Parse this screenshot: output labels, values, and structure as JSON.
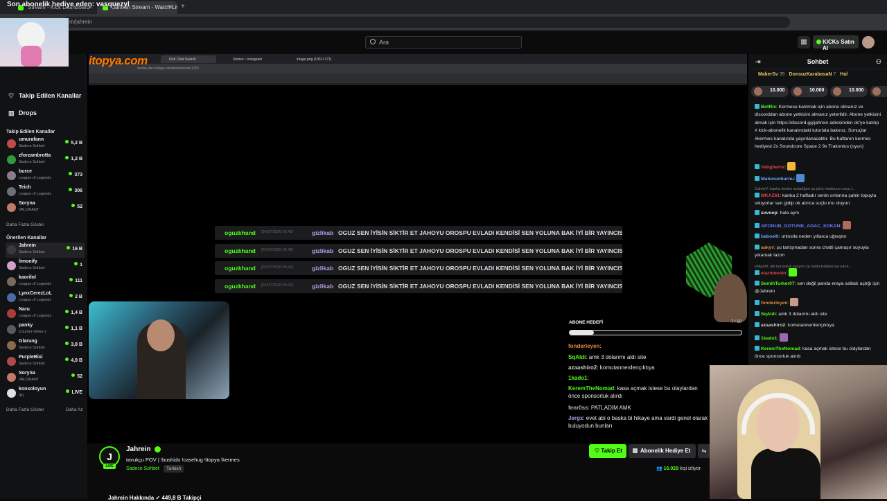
{
  "browser": {
    "tabs": [
      {
        "label": "Stream - Kick Dashboard"
      },
      {
        "label": "Jahrein Stream - Watch Live"
      }
    ],
    "address": "m/jahrein"
  },
  "overlay_banner": "Son abonelik hediye eden: vasquezyl",
  "header": {
    "search_placeholder": "Ara",
    "buy_kicks": "KICKs Satın Al"
  },
  "sidebar": {
    "followed_link": "Takip Edilen Kanallar",
    "drops_link": "Drops",
    "followed_section": "Takip Edilen Kanallar",
    "followed": [
      {
        "name": "umurafann",
        "category": "Sadece Sohbet",
        "viewers": "5,2 B",
        "color": "#c44a4a"
      },
      {
        "name": "zforzambrotta",
        "category": "Sadece Sohbet",
        "viewers": "1,2 B",
        "color": "#2f9b3a"
      },
      {
        "name": "burce",
        "category": "League of Legends",
        "viewers": "373",
        "color": "#8c7b8f"
      },
      {
        "name": "Teich",
        "category": "League of Legends",
        "viewers": "306",
        "color": "#6e6e76"
      },
      {
        "name": "Soryna",
        "category": "VALORANT",
        "viewers": "52",
        "color": "#c27a68"
      }
    ],
    "show_more": "Daha Fazla Göster",
    "recommended_section": "Önerilen Kanallar",
    "recommended": [
      {
        "name": "Jahrein",
        "category": "Sadece Sohbet",
        "viewers": "16 B",
        "color": "#3a3a3a"
      },
      {
        "name": "limonify",
        "category": "Sadece Sohbet",
        "viewers": "1",
        "color": "#d0a0c8"
      },
      {
        "name": "kaorilol",
        "category": "League of Legends",
        "viewers": "111",
        "color": "#7a6a5a"
      },
      {
        "name": "LynxCerezLoL",
        "category": "League of Legends",
        "viewers": "2 B",
        "color": "#4a6aa0"
      },
      {
        "name": "Naru",
        "category": "League of Legends",
        "viewers": "1,4 B",
        "color": "#b03a3a"
      },
      {
        "name": "panky",
        "category": "Counter-Strike 2",
        "viewers": "1,1 B",
        "color": "#5a5a5a"
      },
      {
        "name": "Glarung",
        "category": "Sadece Sohbet",
        "viewers": "3,8 B",
        "color": "#8a6a4a"
      },
      {
        "name": "PurpleBixi",
        "category": "Sadece Sohbet",
        "viewers": "4,9 B",
        "color": "#b04a4a"
      },
      {
        "name": "Soryna",
        "category": "VALORANT",
        "viewers": "52",
        "color": "#c27a68"
      },
      {
        "name": "konsoloyun",
        "category": "IRL",
        "viewers": "LIVE",
        "color": "#e0e0e0"
      }
    ],
    "show_more2": "Daha Fazla Göster",
    "show_less": "Daha Az"
  },
  "stage": {
    "logo": "itopya.com",
    "inner_tabs": [
      "Kick Chat Search",
      "Stories • Instagram",
      "image.png (1061×171)"
    ],
    "inner_address": "media.discordapp.net/attachments/1253...",
    "overlay_chat": [
      {
        "user": "oguzkhand",
        "time": "[24/07/2026 05:42]",
        "target": "gizlikab",
        "text": "OGUZ SEN İYİSİN SİKTİR ET JAHOYU OROSPU EVLADI KENDİSİ SEN YOLUNA BAK İYİ BİR YAYINCISIN"
      },
      {
        "user": "oguzkhand",
        "time": "[24/07/2026 05:42]",
        "target": "gizlikab",
        "text": "OGUZ SEN İYİSİN SİKTİR ET JAHOYU OROSPU EVLADI KENDİSİ SEN YOLUNA BAK İYİ BİR YAYINCISIN"
      },
      {
        "user": "oguzkhand",
        "time": "[24/07/2026 05:42]",
        "target": "gizlikab",
        "text": "OGUZ SEN İYİSİN SİKTİR ET JAHOYU OROSPU EVLADI KENDİSİ SEN YOLUNA BAK İYİ BİR YAYINCISIN"
      },
      {
        "user": "oguzkhand",
        "time": "[24/07/2026 05:42]",
        "target": "gizlikab",
        "text": "OGUZ SEN İYİSİN SİKTİR ET JAHOYU OROSPU EVLADI KENDİSİ SEN YOLUNA BAK İYİ BİR YAYINCISIN"
      }
    ],
    "sub_goal_label": "ABONE HEDEFİ",
    "sub_goal_count": "7 / 50",
    "sub_goal_progress": 0.14,
    "overlay_mini_chat": [
      {
        "user": "fonderleyen",
        "text": ":",
        "color": "#e0893a"
      },
      {
        "user": "SqAldi",
        "text": ": amk 3 dolarımı aldı site",
        "color": "#53fc18"
      },
      {
        "user": "azaashiro2",
        "text": ": komutannerdençıktıya",
        "color": "#cfcfcf"
      },
      {
        "user": "1kado1",
        "text": ":",
        "color": "#53fc18"
      },
      {
        "user": "KeremTheNomad",
        "text": ": kasa açmak istese bu olaylardan önce sponsorluk alırdı",
        "color": "#53fc18"
      },
      {
        "user": "fenr0ss",
        "text": ": PATLADIM AMK",
        "color": "#b0b0b0"
      },
      {
        "user": "Jergx",
        "text": ": evet abi o baska bi hikaye ama vardi genel olarak buluyodun bunları",
        "color": "#b79ae2"
      }
    ]
  },
  "stream_info": {
    "logo_letter": "J",
    "live": "LIVE",
    "name": "Jahrein",
    "title": "tavukçu POV | !bushido !casehug !itopya !kermes",
    "category": "Sadece Sohbet",
    "language": "Turkish",
    "follow": "Takip Et",
    "gift_sub": "Abonelik Hediye Et",
    "more": "⇆",
    "viewers_count": "16.029",
    "viewers_label": "kişi izliyor",
    "about": "Jahrein Hakkında ✓ 449,8 B Takipçi"
  },
  "chat": {
    "title": "Sohbet",
    "gifters": [
      {
        "name": "MakerSv",
        "count": "35"
      },
      {
        "name": "DonsuzKarabasaN",
        "count": "7"
      },
      {
        "name": "Hal",
        "count": ""
      }
    ],
    "pills": [
      "10.000",
      "10.000",
      "10.000",
      "10.000"
    ],
    "messages": [
      {
        "user": "BotRix",
        "color": "#53fc18",
        "text": ": Kermese katılmak için abone olmanız ve discorddan abone yetkisini almanız yeterlidir. Abone yetkisini almak için https://discord.gg/jahrein adresinden dc'ye katılıp # kick-abonelik kanalındaki tutoriala bakınız. Sonuçlar #kermes kanalında yayınlanacaktır. Bu haftanın kermes hediyesi 2x Soundcore Space 2 9x Trakonius (oyun)"
      },
      {
        "user": "Vatighernz",
        "color": "#e0454a",
        "text": ":"
      },
      {
        "user": "Matununburnu",
        "color": "#6aa8ff",
        "text": ":"
      },
      {
        "user": "",
        "color": "#888",
        "text": "CalvinV: kanka benim anladığım şu jaho modunun suçu l..."
      },
      {
        "user": "MKAZ61",
        "color": "#e0454a",
        "text": ": kanka 2 haftadır senin sırlarına şahin topuyla sıkıyorlar sen gidip ok atınca suçlu mu oluyon"
      },
      {
        "user": "svvoop",
        "color": "#e6e6e6",
        "text": ": hala aynı"
      },
      {
        "user": "APONUN_GOTUNE_AGAC_SOKAN",
        "color": "#6a7aff",
        "text": ":"
      },
      {
        "user": "baboelli",
        "color": "#6aa8ff",
        "text": ": unlostla neden yıllarca uğraştın"
      },
      {
        "user": "aakyv",
        "color": "#e0893a",
        "text": ": şu tartışmadan sonra chatti çamaşır suyuyla yıkamak lazım"
      },
      {
        "user": "",
        "color": "#888",
        "text": "eNigi09: abi konsoluk suçyon ya isimli kullanıcıya yanıt..."
      },
      {
        "user": "etarmeenin",
        "color": "#e0454a",
        "text": ":"
      },
      {
        "user": "SemihTurker07",
        "color": "#53fc18",
        "text": ": sen değil panda eraya salladı açtığı için @Jahrein"
      },
      {
        "user": "fonderleyen",
        "color": "#e0893a",
        "text": ":"
      },
      {
        "user": "SqAldi",
        "color": "#53fc18",
        "text": ": amk 3 dolarımı aldı site"
      },
      {
        "user": "azaashiro2",
        "color": "#cfcfcf",
        "text": ": komutannerdençıktıya"
      },
      {
        "user": "1kado1",
        "color": "#53fc18",
        "text": ":"
      },
      {
        "user": "KeremTheNomad",
        "color": "#53fc18",
        "text": ": kasa açmak istese bu olaylardan önce sponsorluk alırdı"
      }
    ]
  }
}
